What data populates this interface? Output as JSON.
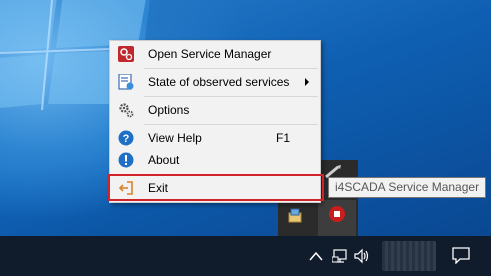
{
  "context_menu": {
    "items": [
      {
        "label": "Open Service Manager",
        "icon": "service-manager-icon"
      },
      {
        "label": "State of observed services",
        "icon": "services-state-icon",
        "has_submenu": true
      },
      {
        "label": "Options",
        "icon": "gears-icon"
      },
      {
        "label": "View Help",
        "icon": "help-icon",
        "shortcut": "F1"
      },
      {
        "label": "About",
        "icon": "info-icon"
      },
      {
        "label": "Exit",
        "icon": "exit-icon",
        "highlighted": true
      }
    ]
  },
  "tooltip": {
    "text": "i4SCADA Service Manager"
  },
  "taskbar": {
    "tray_icons": [
      "chevron-up-icon",
      "network-icon",
      "volume-icon",
      "notification-icon"
    ]
  },
  "colors": {
    "highlight_border": "#d2232a",
    "menu_background": "#f2f2f2",
    "taskbar": "#101c2c",
    "stop_icon": "#c81e1e"
  }
}
